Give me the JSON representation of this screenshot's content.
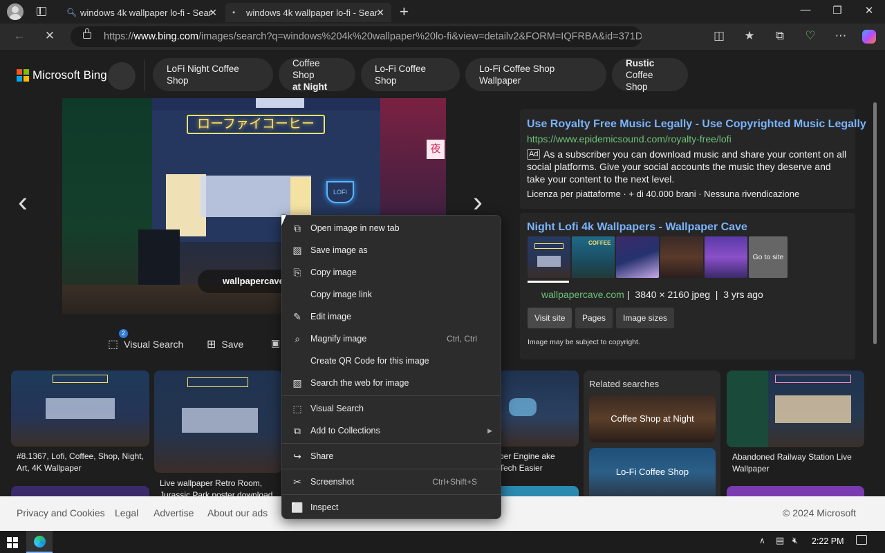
{
  "browser": {
    "tabs": [
      {
        "title": "windows 4k wallpaper lo-fi - Sear"
      },
      {
        "title": "windows 4k wallpaper lo-fi - Sear"
      }
    ],
    "url_prefix": "https://",
    "url_domain": "www.bing.com",
    "url_rest": "/images/search?q=windows%204k%20wallpaper%20lo-fi&view=detailv2&FORM=IQFRBA&id=371D..."
  },
  "bing": {
    "logo_text": "Microsoft Bing",
    "chips": [
      {
        "line1": "LoFi Night Coffee Shop",
        "line2": ""
      },
      {
        "line1": "Coffee Shop",
        "line2": "at Night"
      },
      {
        "line1": "Lo-Fi Coffee Shop",
        "line2": ""
      },
      {
        "line1": "Lo-Fi Coffee Shop Wallpaper",
        "line2": ""
      },
      {
        "line1": "Rustic",
        "line2": "Coffee Shop"
      }
    ]
  },
  "viewer": {
    "sign_text": "ローファイコーヒー",
    "cup_label": "LOFI",
    "kanji": "夜",
    "source_overlay": "wallpapercave",
    "visual_search_badge": "2",
    "visual_search_label": "Visual Search",
    "save_label": "Save"
  },
  "ad": {
    "title": "Use Royalty Free Music Legally - Use Copyrighted Music Legally",
    "url": "https://www.epidemicsound.com/royalty-free/lofi",
    "ad_badge": "Ad",
    "description": "As a subscriber you can download music and share your content on all social platforms. Give your social accounts the music they deserve and take your content to the next level.",
    "footer": "Licenza per piattaforme · + di 40.000 brani · Nessuna rivendicazione"
  },
  "result": {
    "title": "Night Lofi 4k Wallpapers - Wallpaper Cave",
    "go_to_site": "Go to site",
    "thumb_label": "COFFEE",
    "domain": "wallpapercave.com",
    "meta": "|  3840 × 2160 jpeg  |  3 yrs ago",
    "buttons": [
      "Visit site",
      "Pages",
      "Image sizes"
    ],
    "copyright": "Image may be subject to copyright."
  },
  "grid": {
    "captions": [
      "#8.1367, Lofi, Coffee, Shop, Night, Art, 4K Wallpaper",
      "Live wallpaper Retro Room, Jurassic Park poster download on",
      "per Engine ake Tech Easier",
      "Abandoned Railway Station Live Wallpaper"
    ],
    "related_title": "Related searches",
    "related": [
      "Coffee Shop at Night",
      "Lo-Fi Coffee Shop"
    ]
  },
  "footer": {
    "links": [
      "Privacy and Cookies",
      "Legal",
      "Advertise",
      "About our ads"
    ],
    "copyright": "© 2024 Microsoft"
  },
  "context_menu": {
    "items": [
      {
        "label": "Open image in new tab",
        "shortcut": ""
      },
      {
        "label": "Save image as",
        "shortcut": ""
      },
      {
        "label": "Copy image",
        "shortcut": ""
      },
      {
        "label": "Copy image link",
        "shortcut": ""
      },
      {
        "label": "Edit image",
        "shortcut": ""
      },
      {
        "label": "Magnify image",
        "shortcut": "Ctrl, Ctrl"
      },
      {
        "label": "Create QR Code for this image",
        "shortcut": ""
      },
      {
        "label": "Search the web for image",
        "shortcut": ""
      },
      {
        "label": "Visual Search",
        "shortcut": ""
      },
      {
        "label": "Add to Collections",
        "shortcut": ""
      },
      {
        "label": "Share",
        "shortcut": ""
      },
      {
        "label": "Screenshot",
        "shortcut": "Ctrl+Shift+S"
      },
      {
        "label": "Inspect",
        "shortcut": ""
      }
    ]
  },
  "taskbar": {
    "time": "2:22 PM"
  },
  "colors": {
    "link_blue": "#7ab4ff",
    "url_green": "#6ec27a",
    "neon_yellow": "#ffe36a",
    "neon_pink": "#ff4fa5"
  }
}
